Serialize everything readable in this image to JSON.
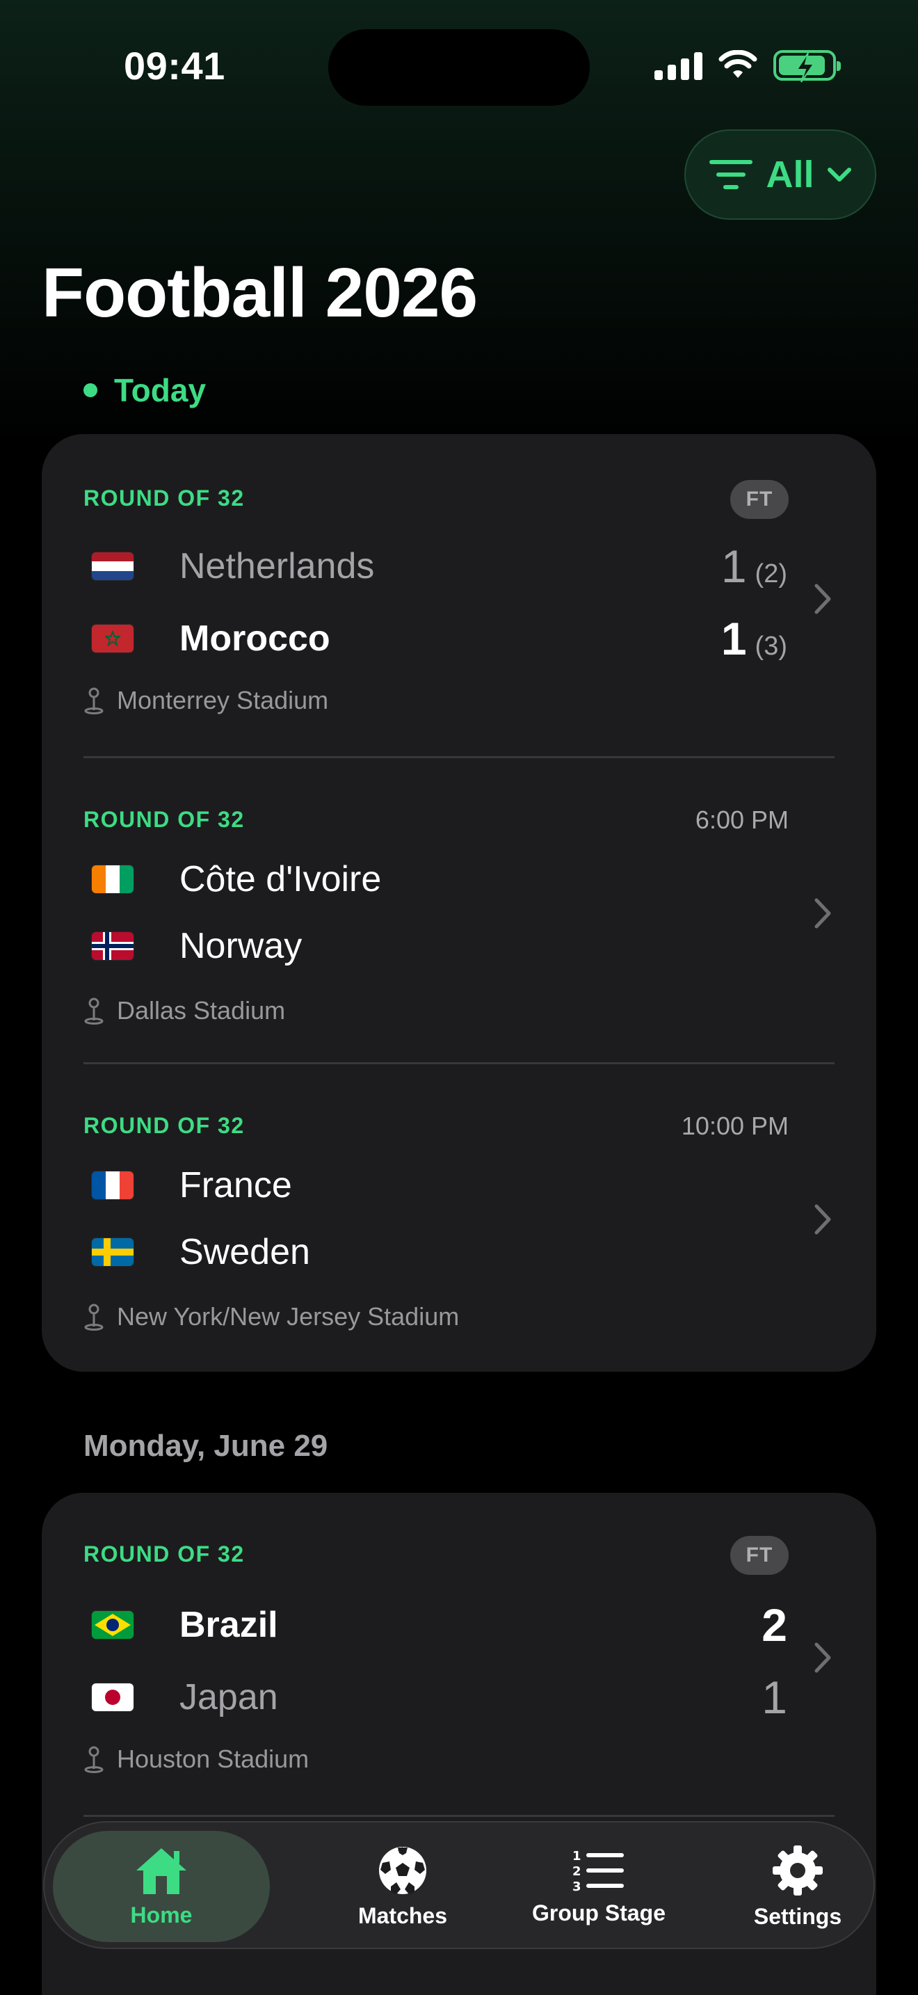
{
  "status_bar": {
    "time": "09:41"
  },
  "header": {
    "filter_label": "All",
    "title": "Football 2026"
  },
  "today_label": "Today",
  "today_matches": [
    {
      "round": "ROUND OF 32",
      "status": "FT",
      "home": {
        "name": "Netherlands",
        "score": "1",
        "penalties": "(2)",
        "flag": "netherlands"
      },
      "away": {
        "name": "Morocco",
        "score": "1",
        "penalties": "(3)",
        "flag": "morocco"
      },
      "venue": "Monterrey Stadium"
    },
    {
      "round": "ROUND OF 32",
      "kickoff": "6:00 PM",
      "home": {
        "name": "Côte d'Ivoire",
        "flag": "ivory-coast"
      },
      "away": {
        "name": "Norway",
        "flag": "norway"
      },
      "venue": "Dallas Stadium"
    },
    {
      "round": "ROUND OF 32",
      "kickoff": "10:00 PM",
      "home": {
        "name": "France",
        "flag": "france"
      },
      "away": {
        "name": "Sweden",
        "flag": "sweden"
      },
      "venue": "New York/New Jersey Stadium"
    }
  ],
  "date_header": "Monday, June 29",
  "monday_matches": [
    {
      "round": "ROUND OF 32",
      "status": "FT",
      "home": {
        "name": "Brazil",
        "score": "2",
        "flag": "brazil"
      },
      "away": {
        "name": "Japan",
        "score": "1",
        "flag": "japan"
      },
      "venue": "Houston Stadium"
    }
  ],
  "tabbar": {
    "tabs": [
      {
        "label": "Home",
        "icon": "house-icon",
        "active": true
      },
      {
        "label": "Matches",
        "icon": "soccer-ball-icon"
      },
      {
        "label": "Group Stage",
        "icon": "numbered-list-icon"
      },
      {
        "label": "Settings",
        "icon": "gear-icon"
      }
    ]
  },
  "colors": {
    "accent": "#3ddc84",
    "card": "#1c1c1e",
    "background": "#000000"
  }
}
